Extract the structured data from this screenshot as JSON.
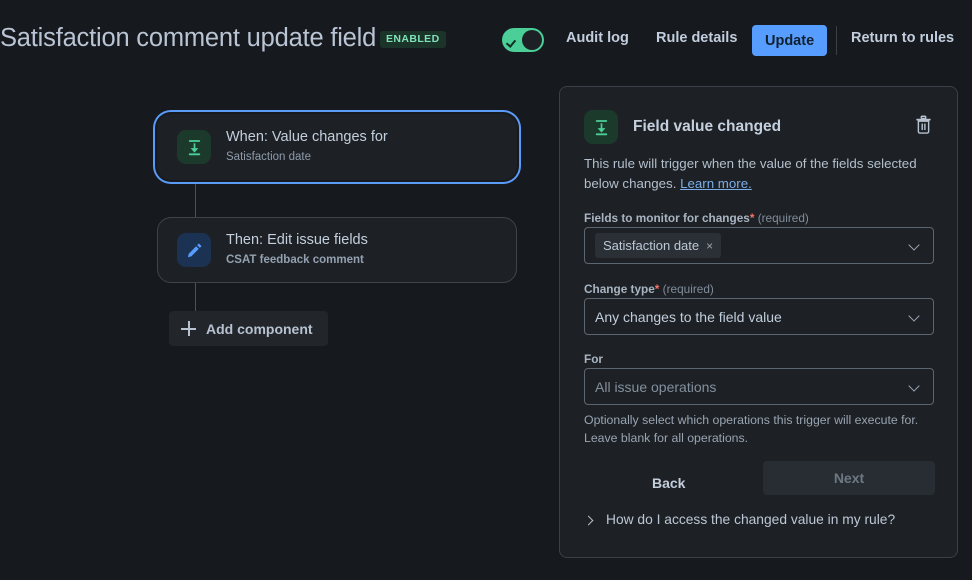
{
  "header": {
    "title": "Satisfaction comment update field",
    "status_badge": "ENABLED",
    "toggle_on": true,
    "nav": {
      "audit_log": "Audit log",
      "rule_details": "Rule details",
      "update": "Update",
      "return_to_rules": "Return to rules"
    }
  },
  "flow": {
    "nodes": [
      {
        "title": "When: Value changes for",
        "subtitle": "Satisfaction date",
        "icon": "field-value-changed-icon",
        "selected": true
      },
      {
        "title": "Then: Edit issue fields",
        "subtitle": "CSAT feedback comment",
        "icon": "pencil-icon",
        "selected": false
      }
    ],
    "add_component_label": "Add component"
  },
  "panel": {
    "title": "Field value changed",
    "delete_icon": "trash-icon",
    "description": "This rule will trigger when the value of the fields selected below changes.",
    "learn_more": "Learn more.",
    "fields_to_monitor": {
      "label": "Fields to monitor for changes",
      "required_star": "*",
      "required_text": "(required)",
      "chips": [
        {
          "label": "Satisfaction date",
          "remove": "×"
        }
      ]
    },
    "change_type": {
      "label": "Change type",
      "required_star": "*",
      "required_text": "(required)",
      "value": "Any changes to the field value"
    },
    "for_field": {
      "label": "For",
      "placeholder": "All issue operations"
    },
    "helper_text": "Optionally select which operations this trigger will execute for. Leave blank for all operations.",
    "buttons": {
      "back": "Back",
      "next": "Next"
    },
    "accordion_label": "How do I access the changed value in my rule?"
  },
  "colors": {
    "page_bg": "#16191d",
    "panel_bg": "#1d2125",
    "accent_blue": "#579dff",
    "toggle_green": "#4bce97",
    "badge_green_text": "#7ee2b8",
    "required_red": "#f87168"
  }
}
